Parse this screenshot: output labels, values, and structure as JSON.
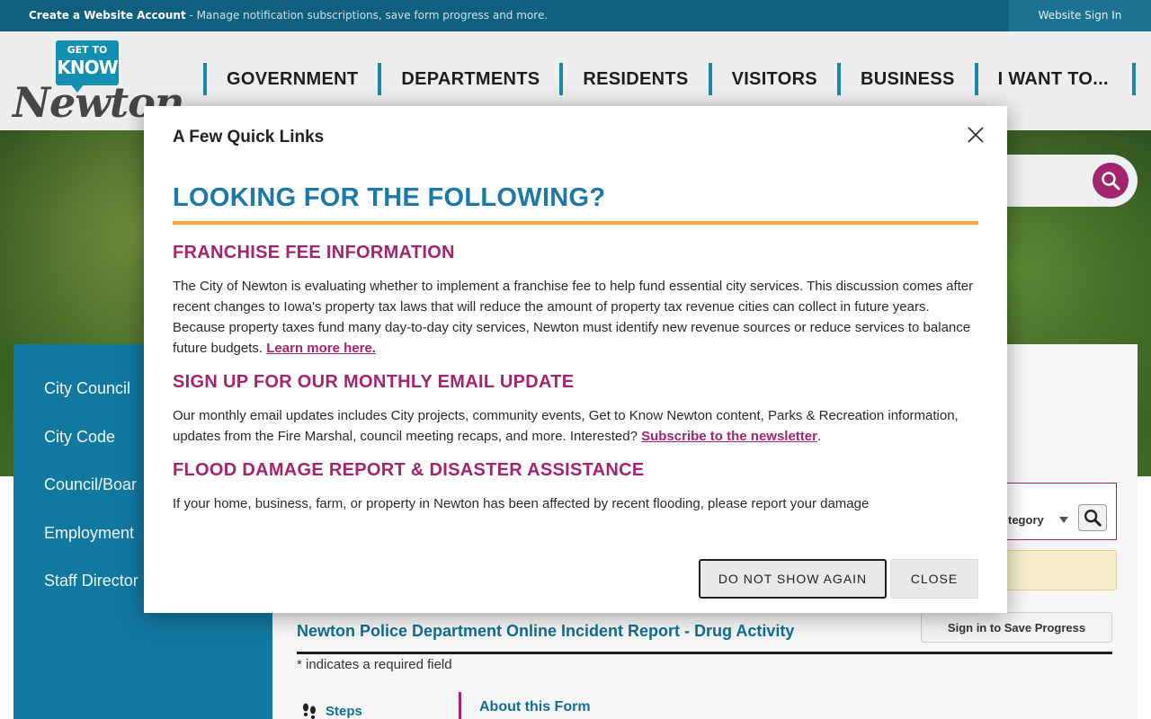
{
  "topbar": {
    "create_label": "Create a Website Account",
    "create_desc": " - Manage notification subscriptions, save form progress and more.",
    "signin_label": "Website Sign In"
  },
  "logo": {
    "line1": "GET TO",
    "line2": "KNOW",
    "word": "Newton"
  },
  "nav": {
    "items": [
      "GOVERNMENT",
      "DEPARTMENTS",
      "RESIDENTS",
      "VISITORS",
      "BUSINESS",
      "I WANT TO..."
    ]
  },
  "sidebar": {
    "items": [
      "City Council",
      "City Code",
      "Council/Boar",
      "Employment",
      "Staff Director"
    ]
  },
  "main": {
    "category_label": "tegory",
    "form_title": "Newton Police Department Online Incident Report - Drug Activity",
    "save_label": "Sign in to Save Progress",
    "required_note": "* indicates a required field",
    "steps_label": "Steps",
    "about_label": "About this Form"
  },
  "modal": {
    "title": "A Few Quick Links",
    "heading": "LOOKING FOR THE FOLLOWING?",
    "sections": [
      {
        "heading": "FRANCHISE FEE INFORMATION",
        "text": "The City of Newton is evaluating whether to implement a franchise fee to help fund essential city services. This discussion comes after recent changes to Iowa's property tax laws that will reduce the amount of property tax revenue cities can collect in future years. Because property taxes fund many day-to-day city services, Newton must identify new revenue sources or reduce services to balance future budgets. ",
        "link": "Learn more here."
      },
      {
        "heading": "SIGN UP FOR OUR MONTHLY EMAIL UPDATE",
        "text": "Our monthly email updates includes City projects, community events, Get to Know Newton content, Parks & Recreation information, updates from the Fire Marshal, council meeting recaps, and more. Interested? ",
        "link": "Subscribe to the newsletter",
        "tail": "."
      },
      {
        "heading": "FLOOD DAMAGE REPORT & DISASTER ASSISTANCE",
        "text": "If your home, business, farm, or property in Newton has been affected by recent flooding, please report your damage"
      }
    ],
    "dont_show_label": "DO NOT SHOW AGAIN",
    "close_label": "CLOSE"
  },
  "colors": {
    "topbar": "#0f5f7e",
    "nav_divider": "#1c87ad",
    "sidebar": "#1178a0",
    "accent_magenta": "#a3246f",
    "heading_blue": "#1a79a6",
    "orange_rule": "#f0a53a"
  },
  "icons": {
    "search": "search-icon",
    "close": "close-icon",
    "steps": "footsteps-icon",
    "dropdown": "chevron-down-icon"
  }
}
